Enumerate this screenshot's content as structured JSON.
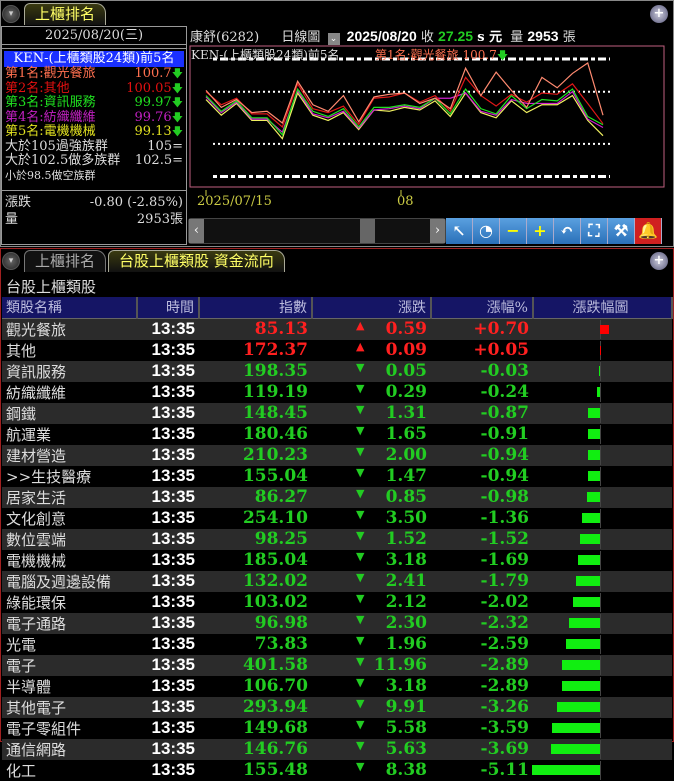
{
  "top": {
    "tab_label": "上櫃排名",
    "date": "2025/08/20(三)",
    "ranking_title": "KEN-(上櫃類股24類)前5名",
    "ranks": [
      {
        "label": "第1名:觀光餐旅",
        "value": "100.7",
        "color": "#ff7050"
      },
      {
        "label": "第2名:其他",
        "value": "100.05",
        "color": "#e01010"
      },
      {
        "label": "第3名:資訊服務",
        "value": "99.97",
        "color": "#20e020"
      },
      {
        "label": "第4名:紡織纖維",
        "value": "99.76",
        "color": "#c020c0"
      },
      {
        "label": "第5名:電機機械",
        "value": "99.13",
        "color": "#e0e020"
      }
    ],
    "thresholds": [
      {
        "label": "大於105過強族群",
        "value": "105="
      },
      {
        "label": "大於102.5做多族群",
        "value": "102.5="
      },
      {
        "label": "小於98.5做空族群",
        "value": ""
      }
    ],
    "change_label": "漲跌",
    "change_value": "-0.80 (-2.85%)",
    "volume_label": "量",
    "volume_value": "2953張"
  },
  "chart_header": {
    "stock": "康舒(6282)",
    "chart_type": "日線圖",
    "date": "2025/08/20",
    "close_label": "收",
    "close_value": "27.25",
    "unit": "s 元",
    "vol_label": "量",
    "vol_value": "2953",
    "vol_unit": "張"
  },
  "chart_data": {
    "type": "line",
    "title": "KEN-(上櫃類股24類)前5名",
    "legend_top": "第1名:觀光餐旅 100.7",
    "x_ticks": [
      "2025/07/15",
      "08"
    ],
    "reference_lines": [
      105,
      102.5,
      98.5,
      96
    ],
    "ylim": [
      95.2,
      106
    ],
    "series": [
      {
        "name": "觀光餐旅",
        "color": "#ff8a70",
        "values": [
          102.6,
          101.3,
          101.9,
          100.9,
          101.0,
          100.1,
          103.3,
          101.5,
          101.0,
          102.2,
          100.2,
          102.1,
          102.3,
          102.4,
          101.6,
          102.0,
          101.2,
          104.3,
          102.2,
          104.0,
          102.6,
          101.3,
          103.6,
          102.8,
          103.9,
          104.7,
          100.7
        ]
      },
      {
        "name": "其他",
        "color": "#e01818",
        "values": [
          102.5,
          101.5,
          102.0,
          100.8,
          100.8,
          99.8,
          103.1,
          101.2,
          100.9,
          101.4,
          100.0,
          102.0,
          102.1,
          102.4,
          101.7,
          102.2,
          101.0,
          103.6,
          102.2,
          101.4,
          102.3,
          101.7,
          102.4,
          102.3,
          103.1,
          101.6,
          100.05
        ]
      },
      {
        "name": "資訊服務",
        "color": "#20e020",
        "values": [
          102.2,
          101.0,
          101.8,
          100.5,
          100.5,
          99.2,
          102.7,
          101.0,
          100.6,
          101.2,
          99.8,
          101.3,
          101.3,
          101.5,
          101.3,
          102.0,
          100.8,
          102.7,
          101.2,
          100.8,
          102.2,
          101.2,
          101.9,
          101.8,
          102.7,
          100.6,
          99.97
        ]
      },
      {
        "name": "紡織纖維",
        "color": "#d020d0",
        "values": [
          102.1,
          100.9,
          101.7,
          100.4,
          100.4,
          99.4,
          102.6,
          100.8,
          100.5,
          101.0,
          99.7,
          101.1,
          101.2,
          101.4,
          101.2,
          102.0,
          102.0,
          102.4,
          101.0,
          100.7,
          101.9,
          101.6,
          101.6,
          101.6,
          102.5,
          100.4,
          99.76
        ]
      },
      {
        "name": "電機機械",
        "color": "#f0f060",
        "values": [
          101.9,
          100.7,
          101.6,
          100.3,
          100.3,
          98.9,
          102.4,
          100.7,
          100.3,
          100.9,
          99.6,
          101.1,
          101.0,
          101.3,
          101.1,
          101.8,
          100.6,
          102.4,
          100.9,
          100.5,
          101.8,
          100.9,
          101.5,
          101.5,
          102.2,
          100.3,
          99.13
        ]
      }
    ]
  },
  "bottom": {
    "tabs": [
      "上櫃排名",
      "台股上櫃類股 資金流向"
    ],
    "title": "台股上櫃類股",
    "columns": [
      "類股名稱",
      "時間",
      "指數",
      "漲跌",
      "漲幅%",
      "漲跌幅圖"
    ],
    "rows": [
      [
        "觀光餐旅",
        "13:35",
        "85.13",
        "0.59",
        "+0.70"
      ],
      [
        "其他",
        "13:35",
        "172.37",
        "0.09",
        "+0.05"
      ],
      [
        "資訊服務",
        "13:35",
        "198.35",
        "0.05",
        "-0.03"
      ],
      [
        "紡織纖維",
        "13:35",
        "119.19",
        "0.29",
        "-0.24"
      ],
      [
        "鋼鐵",
        "13:35",
        "148.45",
        "1.31",
        "-0.87"
      ],
      [
        "航運業",
        "13:35",
        "180.46",
        "1.65",
        "-0.91"
      ],
      [
        "建材營造",
        "13:35",
        "210.23",
        "2.00",
        "-0.94"
      ],
      [
        ">>生技醫療",
        "13:35",
        "155.04",
        "1.47",
        "-0.94"
      ],
      [
        "居家生活",
        "13:35",
        "86.27",
        "0.85",
        "-0.98"
      ],
      [
        "文化創意",
        "13:35",
        "254.10",
        "3.50",
        "-1.36"
      ],
      [
        "數位雲端",
        "13:35",
        "98.25",
        "1.52",
        "-1.52"
      ],
      [
        "電機機械",
        "13:35",
        "185.04",
        "3.18",
        "-1.69"
      ],
      [
        "電腦及週邊設備",
        "13:35",
        "132.02",
        "2.41",
        "-1.79"
      ],
      [
        "綠能環保",
        "13:35",
        "103.02",
        "2.12",
        "-2.02"
      ],
      [
        "電子通路",
        "13:35",
        "96.98",
        "2.30",
        "-2.32"
      ],
      [
        "光電",
        "13:35",
        "73.83",
        "1.96",
        "-2.59"
      ],
      [
        "電子",
        "13:35",
        "401.58",
        "11.96",
        "-2.89"
      ],
      [
        "半導體",
        "13:35",
        "106.70",
        "3.18",
        "-2.89"
      ],
      [
        "其他電子",
        "13:35",
        "293.94",
        "9.91",
        "-3.26"
      ],
      [
        "電子零組件",
        "13:35",
        "149.68",
        "5.58",
        "-3.59"
      ],
      [
        "通信網路",
        "13:35",
        "146.76",
        "5.63",
        "-3.69"
      ],
      [
        "化工",
        "13:35",
        "155.48",
        "8.38",
        "-5.11"
      ]
    ]
  }
}
